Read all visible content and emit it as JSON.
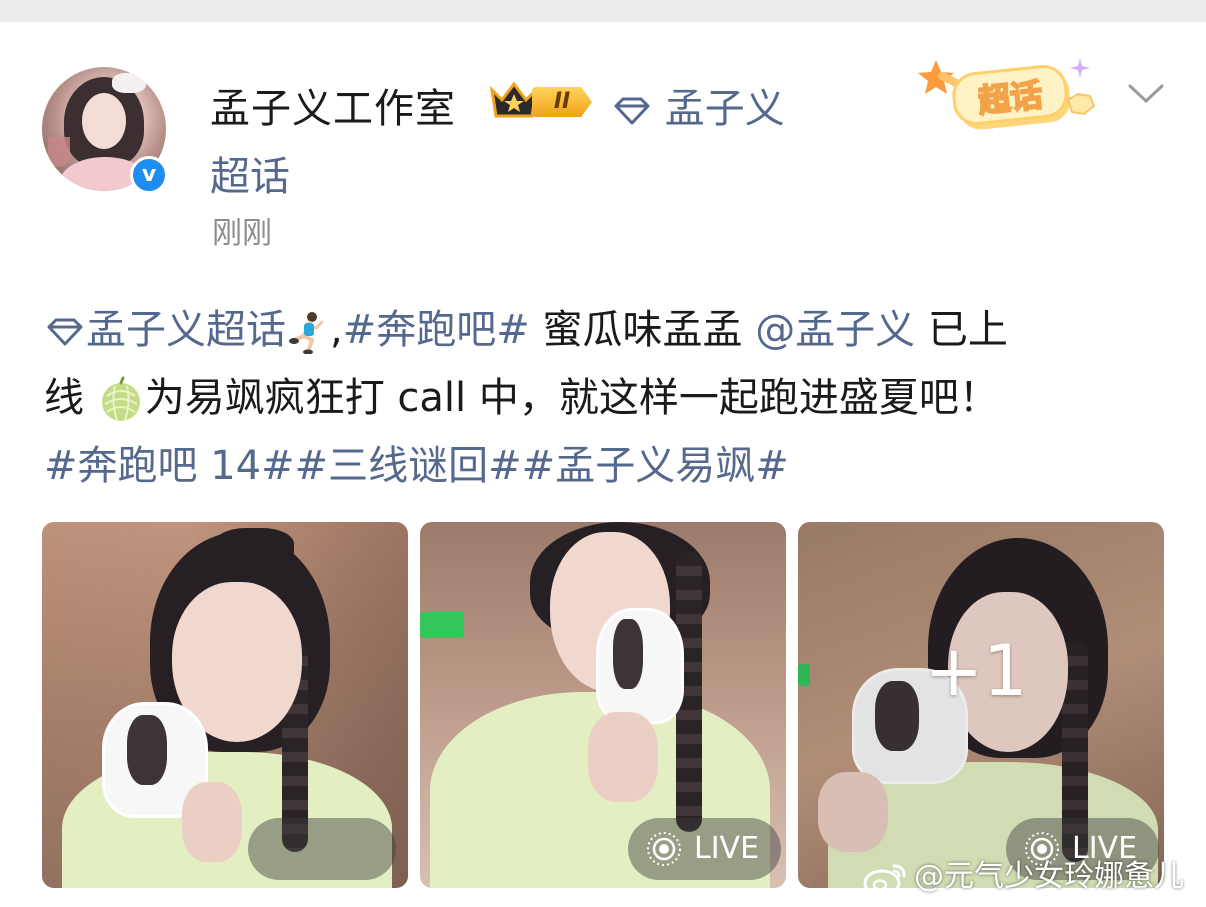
{
  "post": {
    "author": {
      "name": "孟子义工作室",
      "rank_level": "II",
      "verified_mark": "v"
    },
    "super_topic_line1": "孟子义",
    "super_topic_line2": "超话",
    "time": "刚刚",
    "chaohua_badge_label": "超话",
    "content": {
      "topic_link": "孟子义超话",
      "hashtag1": "#奔跑吧#",
      "text1": " 蜜瓜味孟孟",
      "mention": "@孟子义",
      "text2": " 已上",
      "text3": "线",
      "text4": "为易飒疯狂打 call 中，就这样一起跑进盛夏吧！",
      "hashtags_line": "#奔跑吧 14##三线谜回##孟子义易飒#"
    },
    "images": {
      "live_label": "LIVE",
      "more_count": "+1"
    },
    "watermark": "@元气少女玲娜惫儿",
    "icons": {
      "diamond": "diamond-icon",
      "runner": "runner-emoji-icon",
      "melon": "melon-emoji-icon",
      "crown": "crown-icon",
      "chevron": "chevron-down-icon",
      "live": "live-photo-icon",
      "weibo": "weibo-logo-icon"
    },
    "colors": {
      "link": "#55688d",
      "verify": "#1e8cf0",
      "time": "#8c8c8c"
    }
  }
}
